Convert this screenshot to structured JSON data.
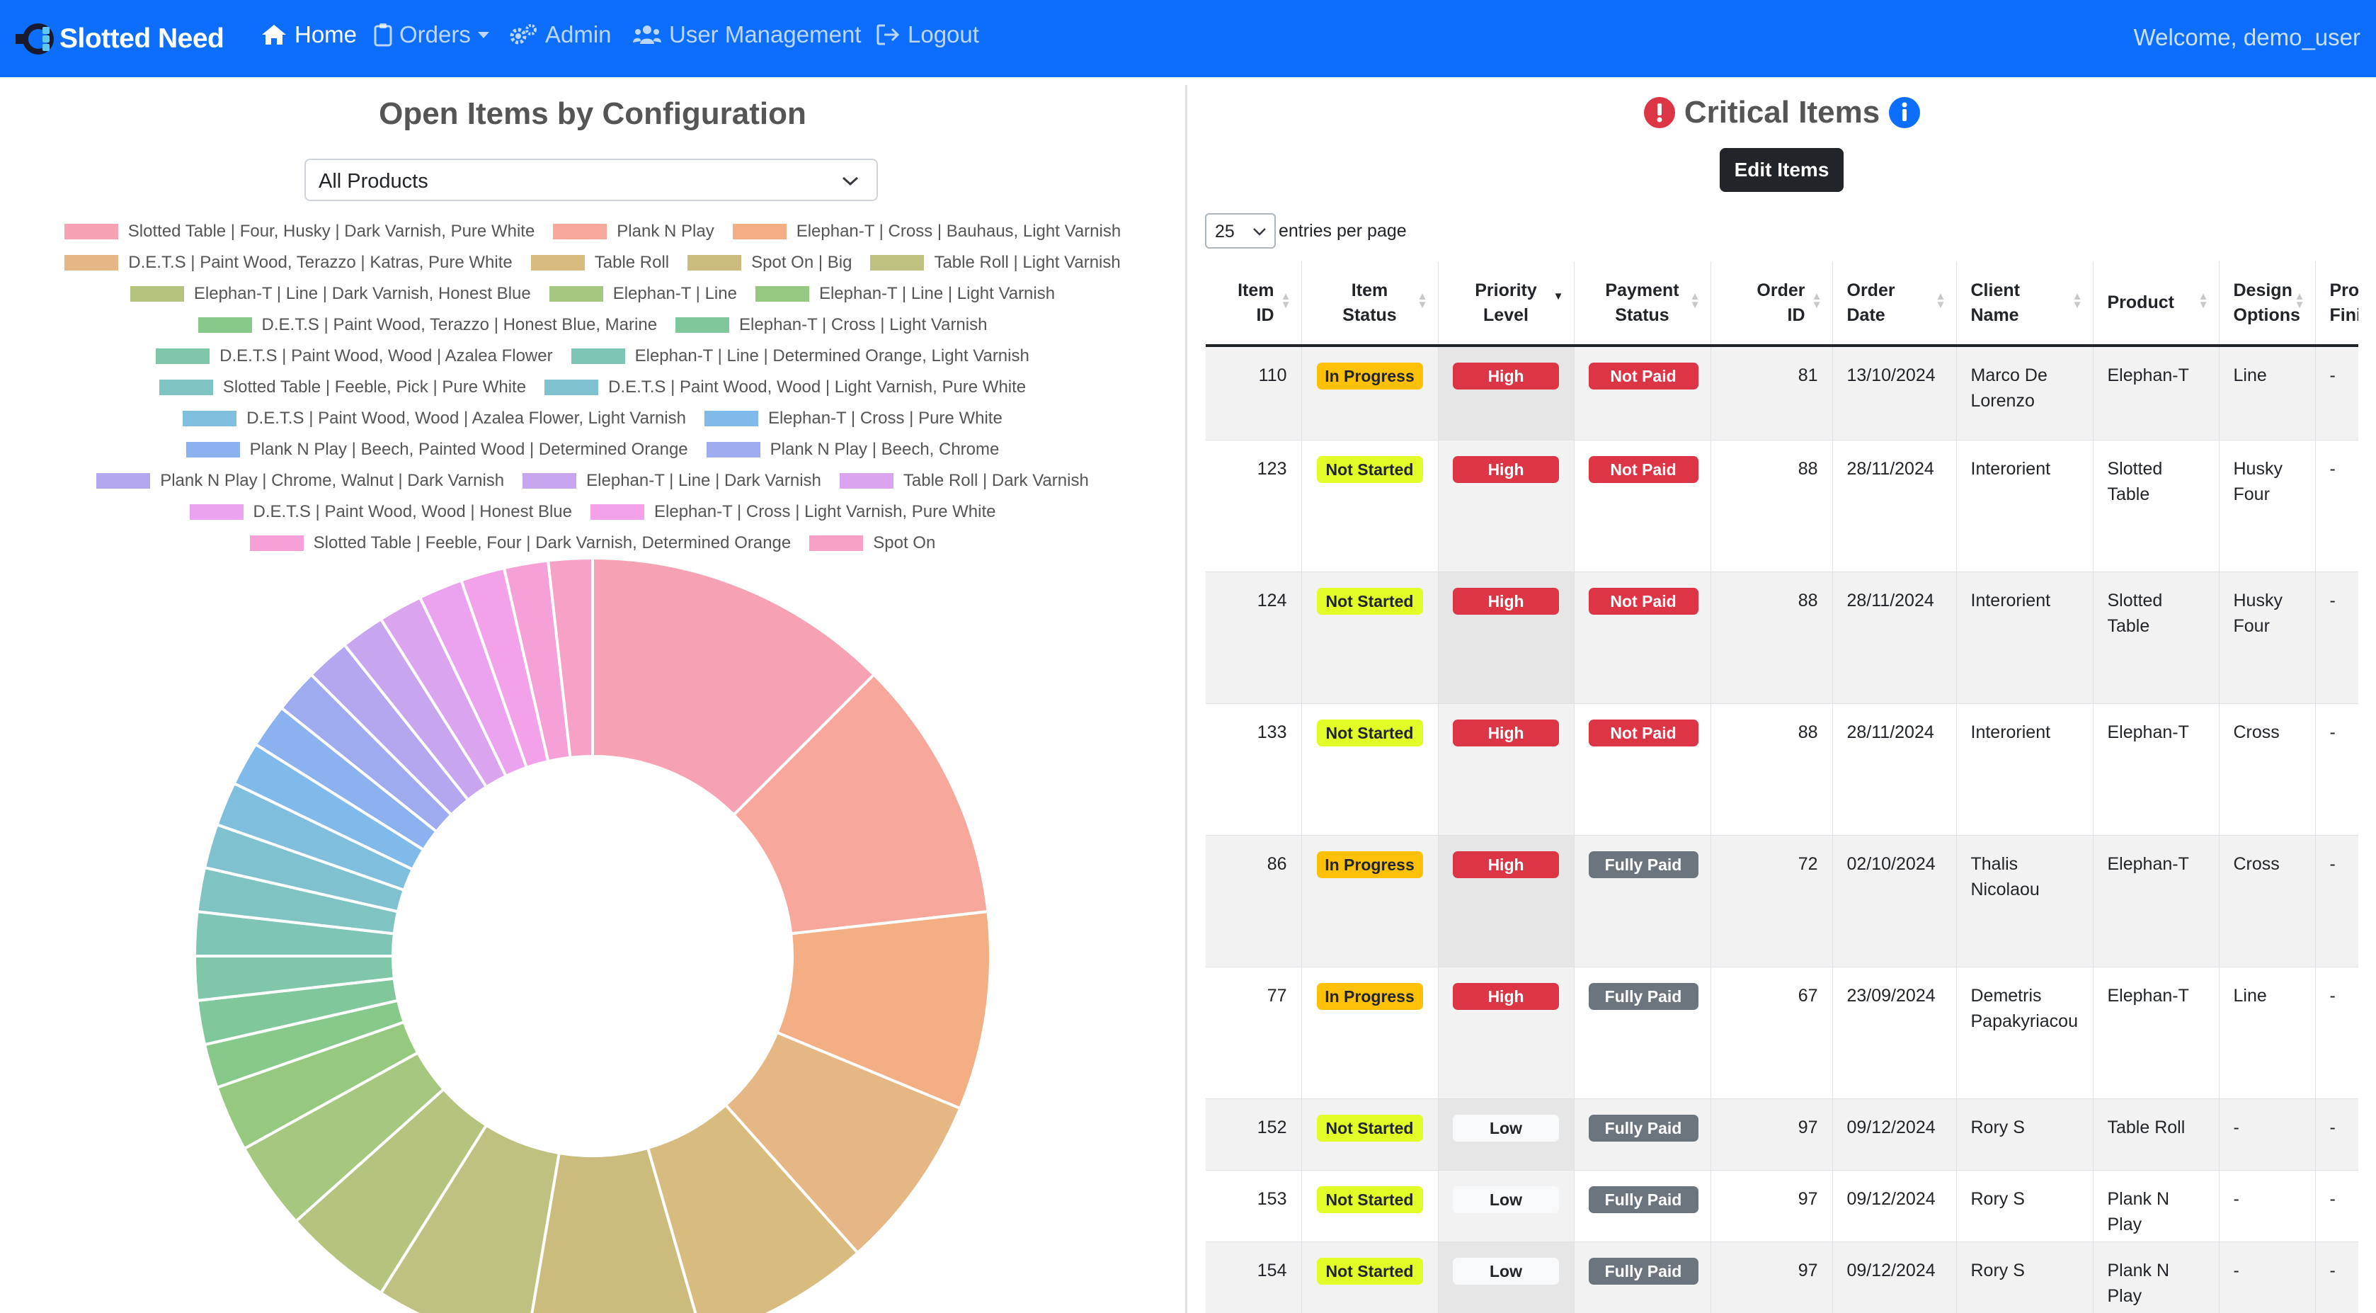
{
  "navbar": {
    "brand": "Slotted Need",
    "items": [
      {
        "label": "Home",
        "icon": "home-icon",
        "active": true
      },
      {
        "label": "Orders",
        "icon": "clipboard-icon",
        "dropdown": true
      },
      {
        "label": "Admin",
        "icon": "gears-icon"
      },
      {
        "label": "User Management",
        "icon": "users-icon"
      },
      {
        "label": "Logout",
        "icon": "logout-icon"
      }
    ],
    "welcome": "Welcome, demo_user"
  },
  "left_panel": {
    "title": "Open Items by Configuration",
    "product_select": {
      "value": "All Products"
    }
  },
  "chart_data": {
    "type": "pie",
    "subtype": "doughnut",
    "legend_position": "top",
    "categories": [
      "Slotted Table | Four, Husky | Dark Varnish, Pure White",
      "Plank N Play",
      "Elephan-T | Cross | Bauhaus, Light Varnish",
      "D.E.T.S | Paint Wood, Terazzo | Katras, Pure White",
      "Table Roll",
      "Spot On | Big",
      "Table Roll | Light Varnish",
      "Elephan-T | Line | Dark Varnish, Honest Blue",
      "Elephan-T | Line",
      "Elephan-T | Line | Light Varnish",
      "D.E.T.S | Paint Wood, Terazzo | Honest Blue, Marine",
      "Elephan-T | Cross | Light Varnish",
      "D.E.T.S | Paint Wood, Wood | Azalea Flower",
      "Elephan-T | Line | Determined Orange, Light Varnish",
      "Slotted Table | Feeble, Pick | Pure White",
      "D.E.T.S | Paint Wood, Wood | Light Varnish, Pure White",
      "D.E.T.S | Paint Wood, Wood | Azalea Flower, Light Varnish",
      "Elephan-T | Cross | Pure White",
      "Plank N Play | Beech, Painted Wood | Determined Orange",
      "Plank N Play | Beech, Chrome",
      "Plank N Play | Chrome, Walnut | Dark Varnish",
      "Elephan-T | Line | Dark Varnish",
      "Table Roll | Dark Varnish",
      "D.E.T.S | Paint Wood, Wood | Honest Blue",
      "Elephan-T | Cross | Light Varnish, Pure White",
      "Slotted Table | Feeble, Four | Dark Varnish, Determined Orange",
      "Spot On"
    ],
    "values": [
      14,
      12,
      9,
      8,
      8,
      8,
      7,
      5,
      4,
      3,
      2,
      2,
      2,
      2,
      2,
      2,
      2,
      2,
      2,
      2,
      2,
      2,
      2,
      2,
      2,
      2,
      2
    ],
    "colors": [
      "#f7a1b5",
      "#f7a79b",
      "#f3ae83",
      "#e5b785",
      "#d8bb7f",
      "#cbbc7e",
      "#bec17f",
      "#b4c47f",
      "#a6c77f",
      "#96c97f",
      "#87c98b",
      "#80c89b",
      "#7fc7a8",
      "#7fc5b5",
      "#7fc3c2",
      "#7fc1cf",
      "#7fbedc",
      "#7fbaea",
      "#8bb2ee",
      "#9fabef",
      "#b4a7ef",
      "#c8a6ef",
      "#dba4ef",
      "#eba3ef",
      "#f3a1e8",
      "#f5a1d7",
      "#f7a1c6"
    ],
    "legend_rows": [
      [
        0,
        1,
        2
      ],
      [
        3,
        4,
        5,
        6
      ],
      [
        7,
        8,
        9
      ],
      [
        10,
        11
      ],
      [
        12,
        13
      ],
      [
        14,
        15
      ],
      [
        16,
        17
      ],
      [
        18,
        19
      ],
      [
        20,
        21,
        22
      ],
      [
        23,
        24
      ],
      [
        25,
        26
      ]
    ]
  },
  "critical_items": {
    "title": "Critical Items",
    "edit_button": "Edit Items",
    "per_page_value": "25",
    "per_page_label": "entries per page",
    "columns": [
      {
        "l1": "Item",
        "l2": "ID",
        "sort": "none"
      },
      {
        "l1": "Item",
        "l2": "Status",
        "sort": "none"
      },
      {
        "l1": "Priority",
        "l2": "Level",
        "sort": "desc"
      },
      {
        "l1": "Payment",
        "l2": "Status",
        "sort": "none"
      },
      {
        "l1": "Order",
        "l2": "ID",
        "sort": "none"
      },
      {
        "l1": "Order",
        "l2": "Date",
        "sort": "none"
      },
      {
        "l1": "Client",
        "l2": "Name",
        "sort": "none"
      },
      {
        "l1": "Product",
        "l2": "",
        "sort": "none"
      },
      {
        "l1": "Design",
        "l2": "Options",
        "sort": "none"
      },
      {
        "l1": "Prod",
        "l2": "Finis",
        "sort": "none"
      }
    ],
    "rows": [
      {
        "item_id": "110",
        "status": "In Progress",
        "priority": "High",
        "payment": "Not Paid",
        "order_id": "81",
        "date": "13/10/2024",
        "client": "Marco De Lorenzo",
        "product": "Elephan-T",
        "design": "Line",
        "finish": "-"
      },
      {
        "item_id": "123",
        "status": "Not Started",
        "priority": "High",
        "payment": "Not Paid",
        "order_id": "88",
        "date": "28/11/2024",
        "client": "Interorient",
        "product": "Slotted Table",
        "design": "Husky Four",
        "finish": "-"
      },
      {
        "item_id": "124",
        "status": "Not Started",
        "priority": "High",
        "payment": "Not Paid",
        "order_id": "88",
        "date": "28/11/2024",
        "client": "Interorient",
        "product": "Slotted Table",
        "design": "Husky Four",
        "finish": "-"
      },
      {
        "item_id": "133",
        "status": "Not Started",
        "priority": "High",
        "payment": "Not Paid",
        "order_id": "88",
        "date": "28/11/2024",
        "client": "Interorient",
        "product": "Elephan-T",
        "design": "Cross",
        "finish": "-"
      },
      {
        "item_id": "86",
        "status": "In Progress",
        "priority": "High",
        "payment": "Fully Paid",
        "order_id": "72",
        "date": "02/10/2024",
        "client": "Thalis Nicolaou",
        "product": "Elephan-T",
        "design": "Cross",
        "finish": "-"
      },
      {
        "item_id": "77",
        "status": "In Progress",
        "priority": "High",
        "payment": "Fully Paid",
        "order_id": "67",
        "date": "23/09/2024",
        "client": "Demetris Papakyriacou",
        "product": "Elephan-T",
        "design": "Line",
        "finish": "-"
      },
      {
        "item_id": "152",
        "status": "Not Started",
        "priority": "Low",
        "payment": "Fully Paid",
        "order_id": "97",
        "date": "09/12/2024",
        "client": "Rory S",
        "product": "Table Roll",
        "design": "-",
        "finish": "-"
      },
      {
        "item_id": "153",
        "status": "Not Started",
        "priority": "Low",
        "payment": "Fully Paid",
        "order_id": "97",
        "date": "09/12/2024",
        "client": "Rory S",
        "product": "Plank N Play",
        "design": "-",
        "finish": "-"
      },
      {
        "item_id": "154",
        "status": "Not Started",
        "priority": "Low",
        "payment": "Fully Paid",
        "order_id": "97",
        "date": "09/12/2024",
        "client": "Rory S",
        "product": "Plank N Play",
        "design": "-",
        "finish": "-"
      }
    ]
  }
}
